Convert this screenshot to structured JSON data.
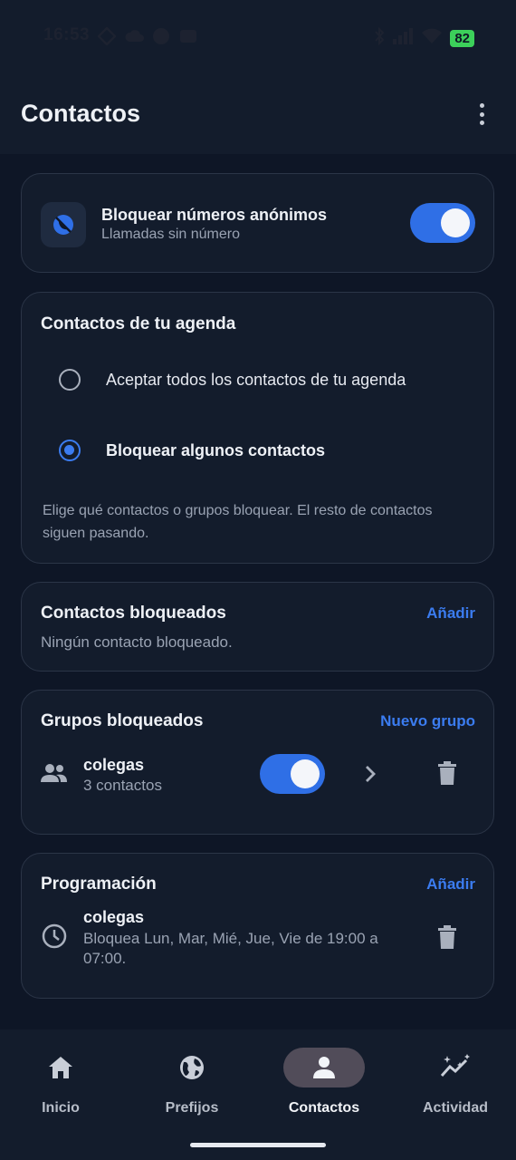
{
  "status_bar": {
    "time": "16:53",
    "battery": "82"
  },
  "app_bar": {
    "title": "Contactos"
  },
  "anonymous": {
    "title": "Bloquear números anónimos",
    "subtitle": "Llamadas sin número",
    "enabled": true
  },
  "agenda": {
    "title": "Contactos de tu agenda",
    "options": [
      {
        "label": "Aceptar todos los contactos de tu agenda",
        "selected": false
      },
      {
        "label": "Bloquear algunos contactos",
        "selected": true
      }
    ],
    "description": "Elige qué contactos o grupos bloquear. El resto de contactos siguen pasando."
  },
  "blocked_contacts": {
    "title": "Contactos bloqueados",
    "action": "Añadir",
    "empty": "Ningún contacto bloqueado."
  },
  "blocked_groups": {
    "title": "Grupos bloqueados",
    "action": "Nuevo grupo",
    "items": [
      {
        "name": "colegas",
        "count": "3 contactos",
        "enabled": true
      }
    ]
  },
  "schedule": {
    "title": "Programación",
    "action": "Añadir",
    "items": [
      {
        "name": "colegas",
        "description": "Bloquea Lun, Mar, Mié, Jue, Vie de 19:00 a 07:00."
      }
    ]
  },
  "bottom_nav": {
    "items": [
      {
        "label": "Inicio",
        "icon": "home-icon"
      },
      {
        "label": "Prefijos",
        "icon": "globe-icon"
      },
      {
        "label": "Contactos",
        "icon": "person-icon",
        "active": true
      },
      {
        "label": "Actividad",
        "icon": "activity-icon"
      }
    ]
  },
  "colors": {
    "accent": "#3b7cf0",
    "background": "#0e1626",
    "card": "#131c2c"
  }
}
